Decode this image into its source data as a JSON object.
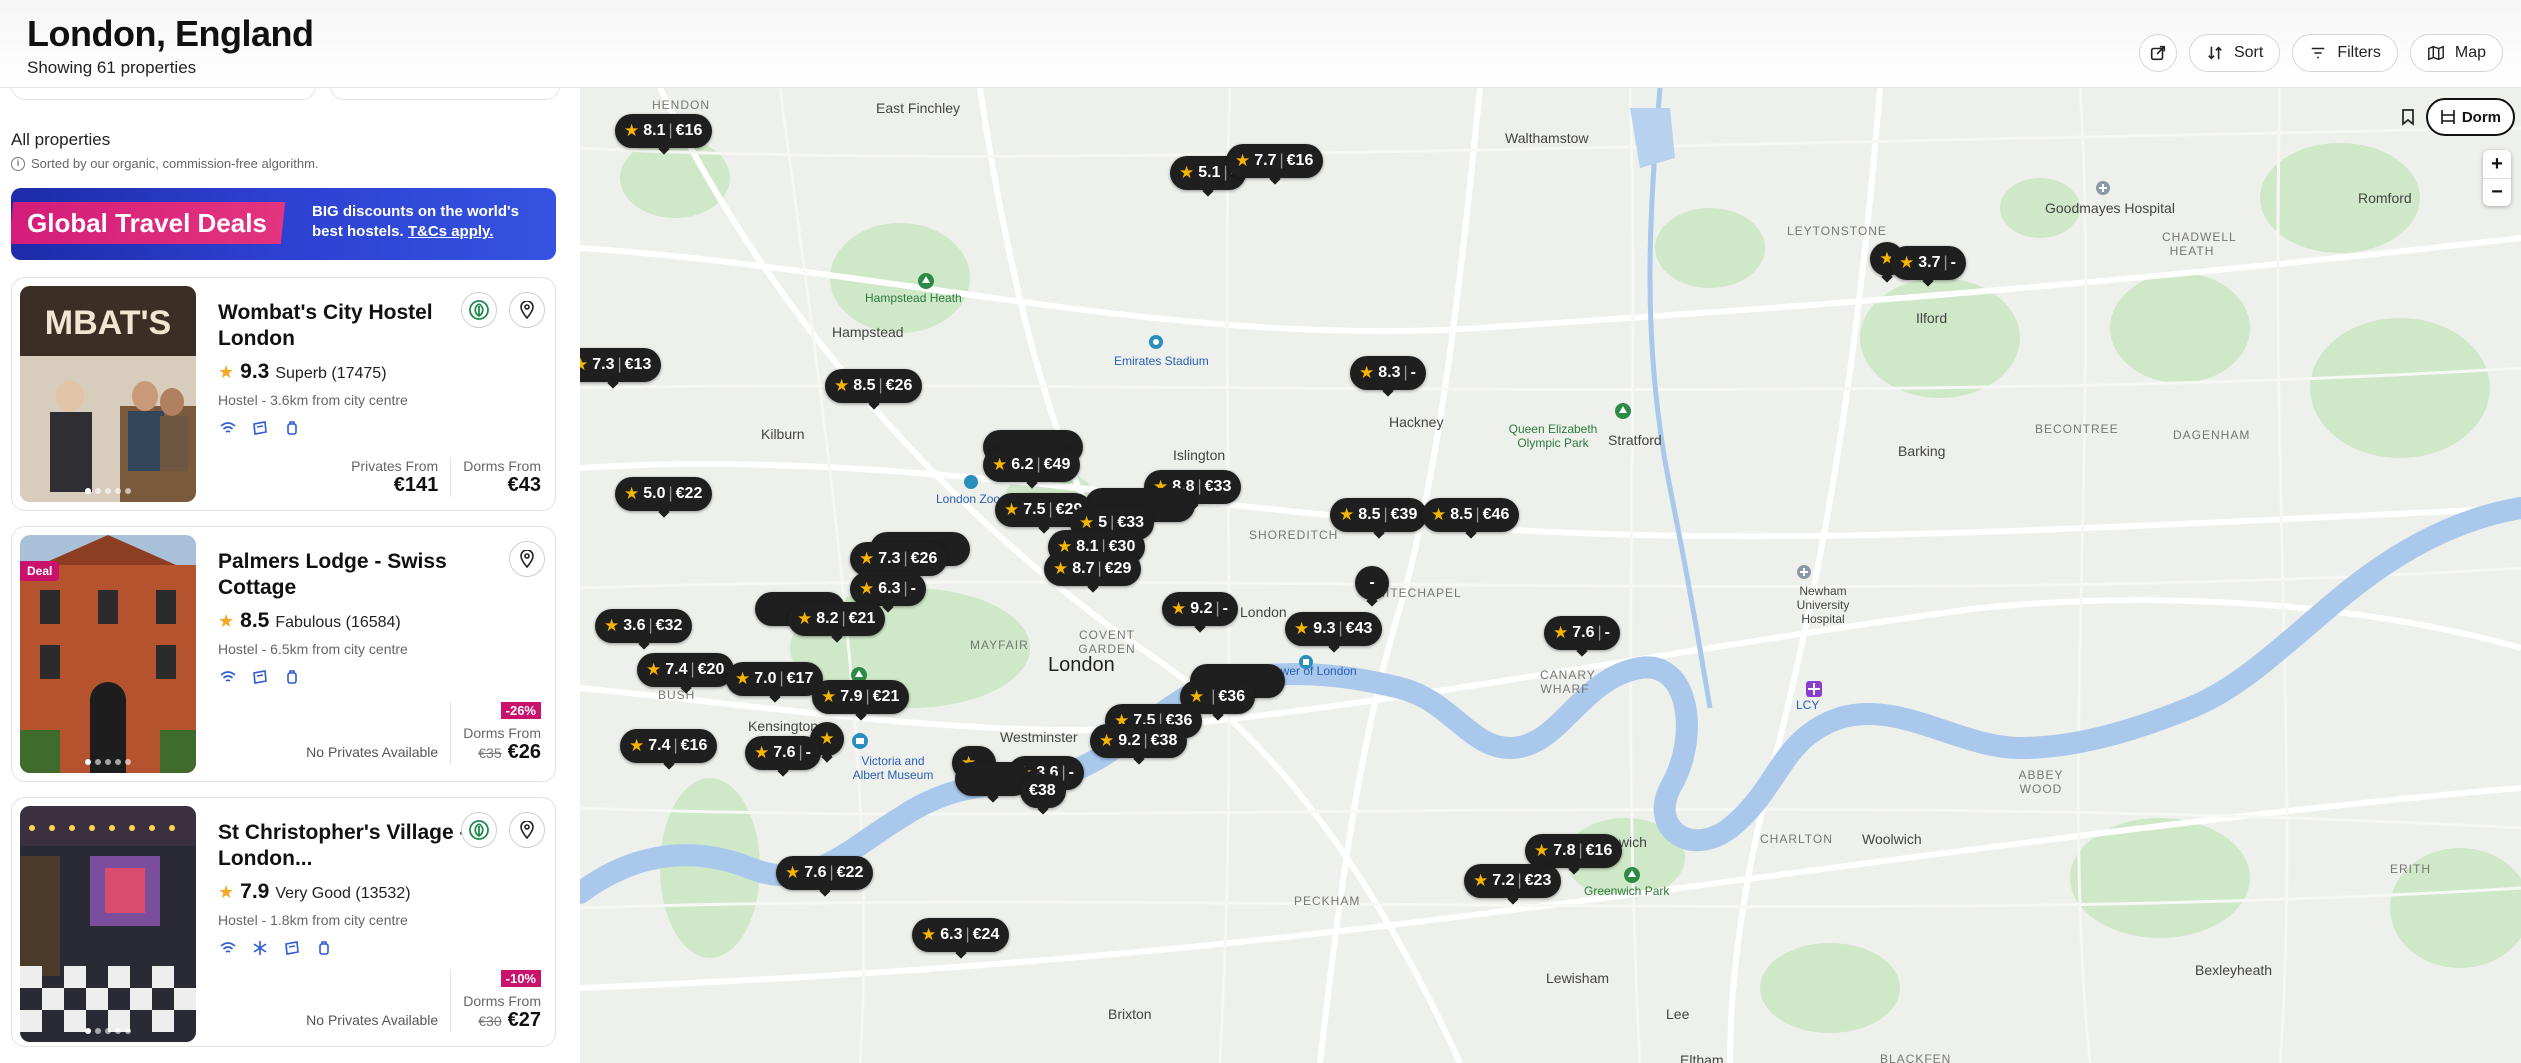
{
  "header": {
    "title": "London, England",
    "subtitle": "Showing 61 properties",
    "share_icon": "share-icon",
    "sort_label": "Sort",
    "filters_label": "Filters",
    "map_label": "Map"
  },
  "list": {
    "heading": "All properties",
    "sorted_note": "Sorted by our organic, commission-free algorithm.",
    "banner": {
      "tag": "Global Travel Deals",
      "line1": "BIG discounts on the world's",
      "line2_prefix": "best hostels. ",
      "line2_link": "T&Cs apply."
    },
    "cards": [
      {
        "name": "Wombat's City Hostel London",
        "score": "9.3",
        "rating_text": "Superb (17475)",
        "meta": "Hostel - 3.6km from city centre",
        "privates_label": "Privates From",
        "privates_price": "€141",
        "dorms_label": "Dorms From",
        "dorms_price": "€43",
        "photo_text": "MBAT'S"
      },
      {
        "name": "Palmers Lodge - Swiss Cottage",
        "score": "8.5",
        "rating_text": "Fabulous (16584)",
        "meta": "Hostel - 6.5km from city centre",
        "deal": "Deal",
        "no_privates": "No Privates Available",
        "discount": "-26%",
        "dorms_label": "Dorms From",
        "old_price": "€35",
        "dorms_price": "€26"
      },
      {
        "name": "St Christopher's Village - London...",
        "score": "7.9",
        "rating_text": "Very Good (13532)",
        "meta": "Hostel - 1.8km from city centre",
        "no_privates": "No Privates Available",
        "discount": "-10%",
        "dorms_label": "Dorms From",
        "old_price": "€30",
        "dorms_price": "€27"
      }
    ]
  },
  "map": {
    "dorm_label": "Dorm",
    "zoom_in": "+",
    "zoom_out": "−",
    "places": [
      {
        "text": "HENDON",
        "cls": "small"
      },
      {
        "text": "East Finchley",
        "cls": ""
      },
      {
        "text": "Walthamstow",
        "cls": ""
      },
      {
        "text": "LEYTONSTONE",
        "cls": "small"
      },
      {
        "text": "Romford",
        "cls": ""
      },
      {
        "text": "Goodmayes Hospital",
        "cls": ""
      },
      {
        "text": "CHADWELL HEATH",
        "cls": "small"
      },
      {
        "text": "Hampstead Heath",
        "cls": "green"
      },
      {
        "text": "Hampstead",
        "cls": ""
      },
      {
        "text": "Emirates Stadium",
        "cls": "blue"
      },
      {
        "text": "Ilford",
        "cls": ""
      },
      {
        "text": "Kilburn",
        "cls": ""
      },
      {
        "text": "Islington",
        "cls": ""
      },
      {
        "text": "Hackney",
        "cls": ""
      },
      {
        "text": "Queen Elizabeth Olympic Park",
        "cls": "green"
      },
      {
        "text": "Stratford",
        "cls": ""
      },
      {
        "text": "BECONTREE",
        "cls": "small"
      },
      {
        "text": "Barking",
        "cls": ""
      },
      {
        "text": "DAGENHAM",
        "cls": "small"
      },
      {
        "text": "London Zoo",
        "cls": "blue"
      },
      {
        "text": "SHOREDITCH",
        "cls": "small"
      },
      {
        "text": "WHITECHAPEL",
        "cls": "small"
      },
      {
        "text": "Newham University Hospital",
        "cls": ""
      },
      {
        "text": "MAYFAIR",
        "cls": "small"
      },
      {
        "text": "COVENT GARDEN",
        "cls": "small"
      },
      {
        "text": "London",
        "cls": "big"
      },
      {
        "text": "Tower of London",
        "cls": "blue"
      },
      {
        "text": "CANARY WHARF",
        "cls": "small"
      },
      {
        "text": "LCY",
        "cls": "blue"
      },
      {
        "text": "Kensington",
        "cls": ""
      },
      {
        "text": "Victoria and Albert Museum",
        "cls": "blue"
      },
      {
        "text": "Westminster",
        "cls": ""
      },
      {
        "text": "ABBEY WOOD",
        "cls": "small"
      },
      {
        "text": "Woolwich",
        "cls": ""
      },
      {
        "text": "CHARLTON",
        "cls": "small"
      },
      {
        "text": "Greenwich Park",
        "cls": "green"
      },
      {
        "text": "PECKHAM",
        "cls": "small"
      },
      {
        "text": "ERITH",
        "cls": "small"
      },
      {
        "text": "Lewisham",
        "cls": ""
      },
      {
        "text": "Bexleyheath",
        "cls": ""
      },
      {
        "text": "Brixton",
        "cls": ""
      },
      {
        "text": "Lee",
        "cls": ""
      },
      {
        "text": "Eltham",
        "cls": ""
      },
      {
        "text": "BLACKFEN",
        "cls": "small"
      },
      {
        "text": "BUSH",
        "cls": "small"
      },
      {
        "text": "London",
        "cls": ""
      },
      {
        "text": "Greenwich",
        "cls": ""
      }
    ],
    "markers": [
      {
        "score": "8.1",
        "price": "€16"
      },
      {
        "score": "5.1",
        "price": "-"
      },
      {
        "score": "7.7",
        "price": "€16"
      },
      {
        "score": "",
        "price": ""
      },
      {
        "score": "3.7",
        "price": "-"
      },
      {
        "score": "7.3",
        "price": "€13"
      },
      {
        "score": "8.5",
        "price": "€26"
      },
      {
        "score": "8.3",
        "price": "-"
      },
      {
        "score": "6.2",
        "price": "€49"
      },
      {
        "score": "8.8",
        "price": "€33"
      },
      {
        "score": "5.0",
        "price": "€22"
      },
      {
        "score": "7.5",
        "price": "€29"
      },
      {
        "score": "5",
        "price": "€33"
      },
      {
        "score": "8.5",
        "price": "€39"
      },
      {
        "score": "8.5",
        "price": "€46"
      },
      {
        "score": "8.1",
        "price": "€30"
      },
      {
        "score": "7.3",
        "price": "€26"
      },
      {
        "score": "8.7",
        "price": "€29"
      },
      {
        "score": "",
        "price": "-"
      },
      {
        "score": "6.3",
        "price": "-"
      },
      {
        "score": "9.2",
        "price": "-"
      },
      {
        "score": "8.2",
        "price": "€21"
      },
      {
        "score": "9.3",
        "price": "€43"
      },
      {
        "score": "3.6",
        "price": "€32"
      },
      {
        "score": "7.6",
        "price": "-"
      },
      {
        "score": "7.4",
        "price": "€20"
      },
      {
        "score": "7.0",
        "price": "€17"
      },
      {
        "score": "7.9",
        "price": "€21"
      },
      {
        "score": "",
        "price": "€36"
      },
      {
        "score": "7.4",
        "price": "€16"
      },
      {
        "score": "7.6",
        "price": "-"
      },
      {
        "score": "7.5",
        "price": "€36"
      },
      {
        "score": "9.2",
        "price": "€38"
      },
      {
        "score": "",
        "price": "-"
      },
      {
        "score": "3.6",
        "price": "-"
      },
      {
        "score": "",
        "price": "€38"
      },
      {
        "score": "7.8",
        "price": "€16"
      },
      {
        "score": "7.2",
        "price": "€23"
      },
      {
        "score": "7.6",
        "price": "€22"
      },
      {
        "score": "6.3",
        "price": "€24"
      }
    ]
  }
}
